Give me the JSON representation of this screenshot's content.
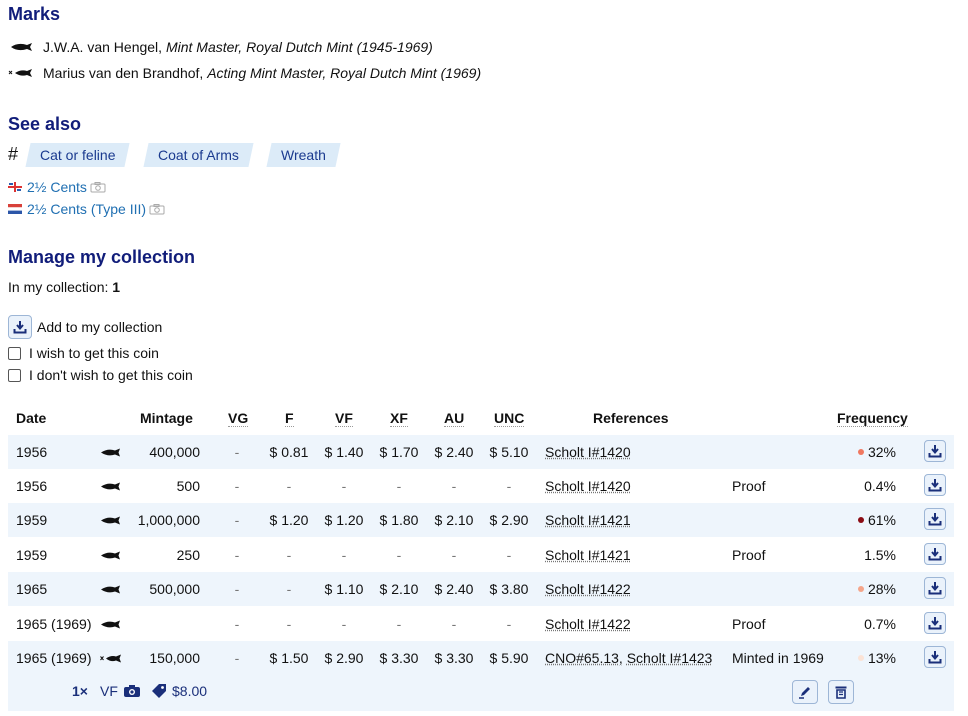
{
  "marks": {
    "heading": "Marks",
    "items": [
      {
        "name": "J.W.A. van Hengel,",
        "role": "Mint Master, Royal Dutch Mint (1945-1969)"
      },
      {
        "name": "Marius van den Brandhof,",
        "role": "Acting Mint Master, Royal Dutch Mint (1969)"
      }
    ]
  },
  "see_also": {
    "heading": "See also",
    "hash": "#",
    "tags": [
      "Cat or feline",
      "Coat of Arms",
      "Wreath"
    ],
    "links": [
      "2½ Cents",
      "2½ Cents (Type III)"
    ]
  },
  "manage": {
    "heading": "Manage my collection",
    "in_collection_label": "In my collection:",
    "in_collection_count": "1",
    "add_label": "Add to my collection",
    "wish_label": "I wish to get this coin",
    "nowish_label": "I don't wish to get this coin"
  },
  "table": {
    "headers": [
      "Date",
      "Mintage",
      "VG",
      "F",
      "VF",
      "XF",
      "AU",
      "UNC",
      "References",
      "Frequency"
    ],
    "rows": [
      {
        "date": "1956",
        "mark": "fish",
        "mintage": "400,000",
        "vg": "-",
        "f": "$ 0.81",
        "vf": "$ 1.40",
        "xf": "$ 1.70",
        "au": "$ 2.40",
        "unc": "$ 5.10",
        "ref1": "Scholt I#1420",
        "ref2": "",
        "note": "",
        "freq": "32%",
        "dot": "#f07860"
      },
      {
        "date": "1956",
        "mark": "fish",
        "mintage": "500",
        "vg": "-",
        "f": "-",
        "vf": "-",
        "xf": "-",
        "au": "-",
        "unc": "-",
        "ref1": "Scholt I#1420",
        "ref2": "",
        "note": "Proof",
        "freq": "0.4%",
        "dot": ""
      },
      {
        "date": "1959",
        "mark": "fish",
        "mintage": "1,000,000",
        "vg": "-",
        "f": "$ 1.20",
        "vf": "$ 1.20",
        "xf": "$ 1.80",
        "au": "$ 2.10",
        "unc": "$ 2.90",
        "ref1": "Scholt I#1421",
        "ref2": "",
        "note": "",
        "freq": "61%",
        "dot": "#8b0c14"
      },
      {
        "date": "1959",
        "mark": "fish",
        "mintage": "250",
        "vg": "-",
        "f": "-",
        "vf": "-",
        "xf": "-",
        "au": "-",
        "unc": "-",
        "ref1": "Scholt I#1421",
        "ref2": "",
        "note": "Proof",
        "freq": "1.5%",
        "dot": ""
      },
      {
        "date": "1965",
        "mark": "fish",
        "mintage": "500,000",
        "vg": "-",
        "f": "-",
        "vf": "$ 1.10",
        "xf": "$ 2.10",
        "au": "$ 2.40",
        "unc": "$ 3.80",
        "ref1": "Scholt I#1422",
        "ref2": "",
        "note": "",
        "freq": "28%",
        "dot": "#f4a58a"
      },
      {
        "date": "1965 (1969)",
        "mark": "fish",
        "mintage": "",
        "vg": "-",
        "f": "-",
        "vf": "-",
        "xf": "-",
        "au": "-",
        "unc": "-",
        "ref1": "Scholt I#1422",
        "ref2": "",
        "note": "Proof",
        "freq": "0.7%",
        "dot": ""
      },
      {
        "date": "1965 (1969)",
        "mark": "starfish",
        "mintage": "150,000",
        "vg": "-",
        "f": "$ 1.50",
        "vf": "$ 2.90",
        "xf": "$ 3.30",
        "au": "$ 3.30",
        "unc": "$ 5.90",
        "ref1": "CNO#65.13,",
        "ref2": "Scholt I#1423",
        "note": "Minted in 1969",
        "freq": "13%",
        "dot": "#fbe3d6"
      }
    ],
    "collection_entry": {
      "qty": "1×",
      "grade": "VF",
      "price": "$8.00"
    }
  },
  "colors": {
    "heading": "#111d7a",
    "link": "#1f6fb2",
    "row_alt": "#eef5fc",
    "tag_bg": "#dcebf8"
  }
}
